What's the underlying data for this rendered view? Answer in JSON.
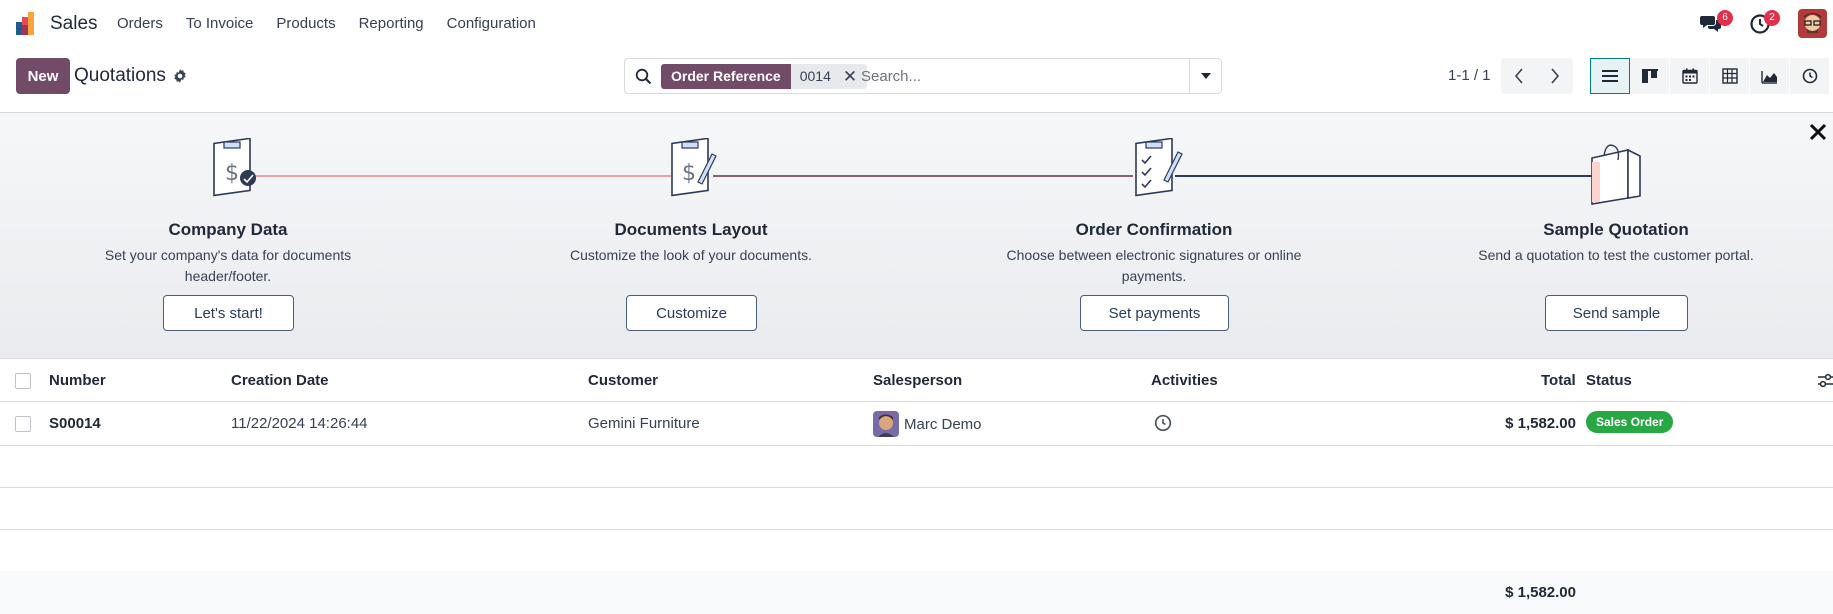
{
  "navbar": {
    "app_name": "Sales",
    "menu": [
      "Orders",
      "To Invoice",
      "Products",
      "Reporting",
      "Configuration"
    ],
    "messages_count": "6",
    "activities_count": "2"
  },
  "control": {
    "new_label": "New",
    "title": "Quotations",
    "search": {
      "facet_label": "Order Reference",
      "facet_value": "0014",
      "placeholder": "Search..."
    },
    "pager": "1-1 / 1",
    "views": [
      "list",
      "kanban",
      "calendar",
      "pivot",
      "graph",
      "activity"
    ]
  },
  "onboarding": {
    "steps": [
      {
        "title": "Company Data",
        "description": "Set your company's data for documents header/footer.",
        "button": "Let's start!"
      },
      {
        "title": "Documents Layout",
        "description": "Customize the look of your documents.",
        "button": "Customize"
      },
      {
        "title": "Order Confirmation",
        "description": "Choose between electronic signatures or online payments.",
        "button": "Set payments"
      },
      {
        "title": "Sample Quotation",
        "description": "Send a quotation to test the customer portal.",
        "button": "Send sample"
      }
    ]
  },
  "table": {
    "columns": [
      "Number",
      "Creation Date",
      "Customer",
      "Salesperson",
      "Activities",
      "Total",
      "Status"
    ],
    "rows": [
      {
        "number": "S00014",
        "creation_date": "11/22/2024 14:26:44",
        "customer": "Gemini Furniture",
        "salesperson": "Marc Demo",
        "total": "$ 1,582.00",
        "status": "Sales Order"
      }
    ],
    "footer_total": "$ 1,582.00"
  },
  "colors": {
    "brand": "#714b67",
    "status_success": "#28a745",
    "active_view": "#017e84",
    "badge": "#e0304b"
  }
}
